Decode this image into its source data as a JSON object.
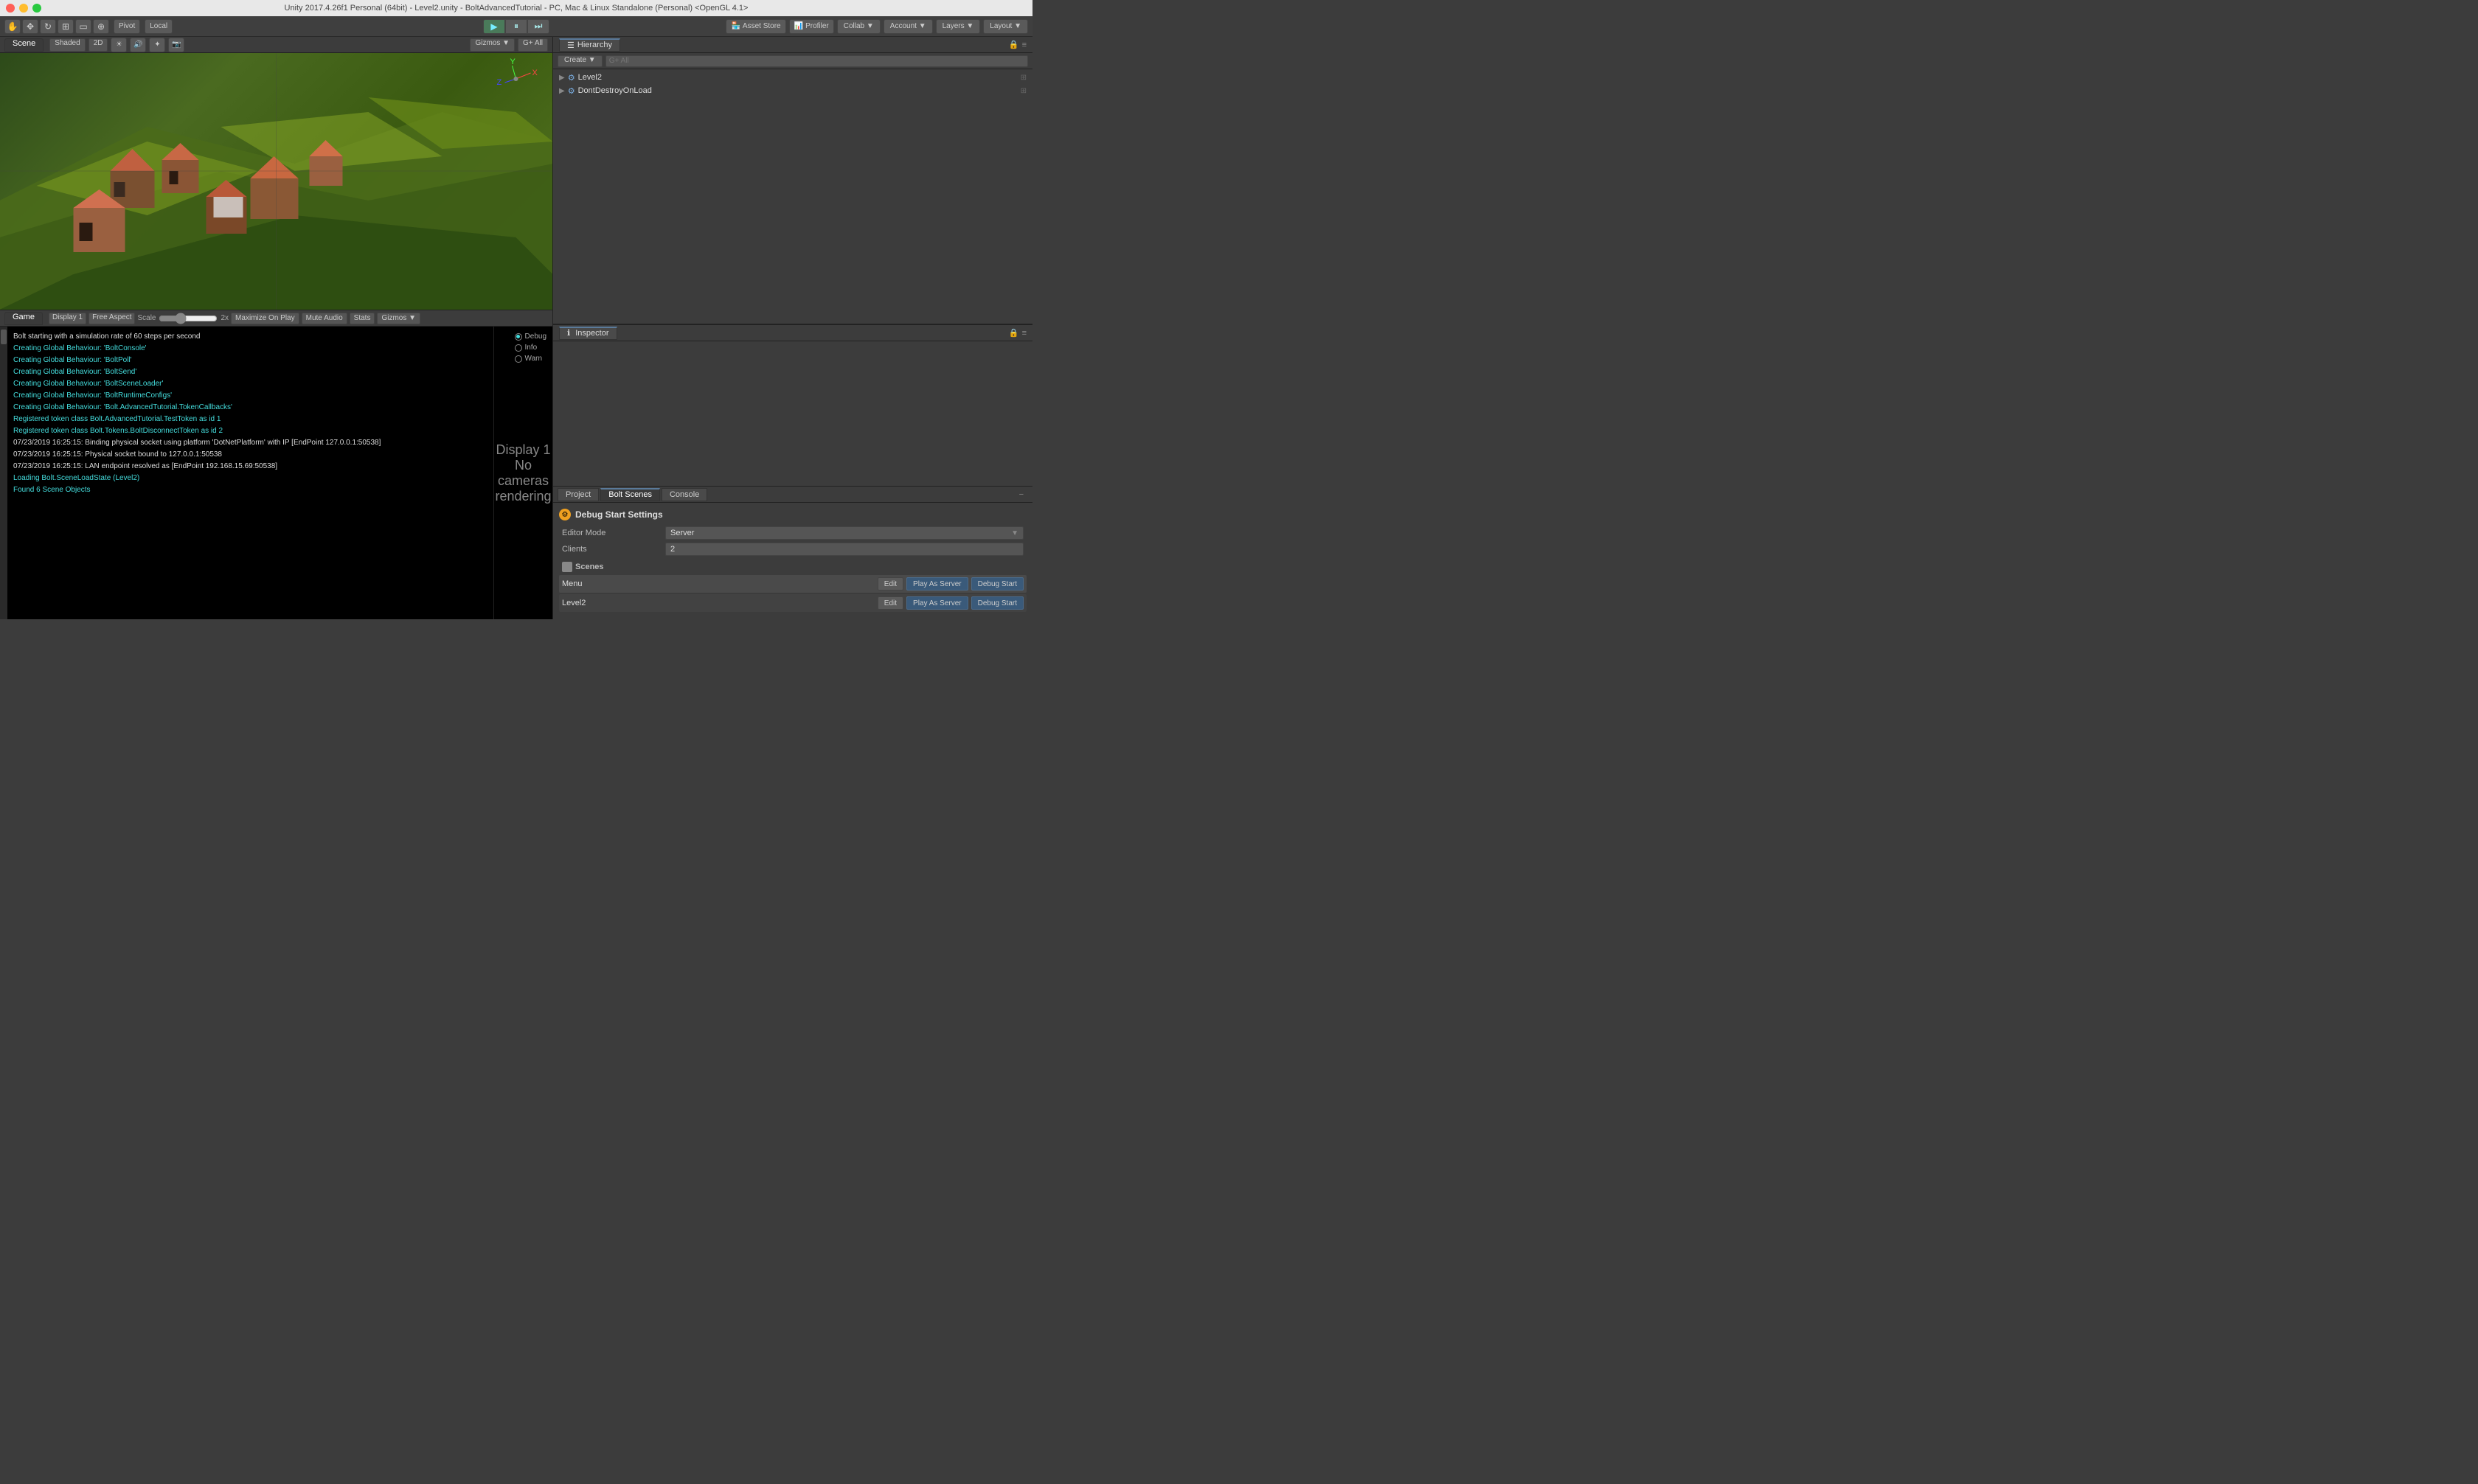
{
  "titlebar": {
    "text": "Unity 2017.4.26f1 Personal (64bit) - Level2.unity - BoltAdvancedTutorial - PC, Mac & Linux Standalone (Personal) <OpenGL 4.1>"
  },
  "toolbar": {
    "pivot_label": "Pivot",
    "local_label": "Local",
    "asset_store_label": "Asset Store",
    "profiler_label": "Profiler",
    "collab_label": "Collab ▼",
    "account_label": "Account ▼",
    "layers_label": "Layers ▼",
    "layout_label": "Layout ▼"
  },
  "scene_view": {
    "tab_label": "Scene",
    "shading_label": "Shaded",
    "mode_2d": "2D",
    "gizmos_label": "Gizmos ▼",
    "all_label": "G+ All"
  },
  "game_view": {
    "tab_label": "Game",
    "display_label": "Display 1",
    "aspect_label": "Free Aspect",
    "scale_label": "Scale",
    "scale_value": "2x",
    "maximize_label": "Maximize On Play",
    "mute_label": "Mute Audio",
    "stats_label": "Stats",
    "gizmos_label": "Gizmos ▼",
    "display_title": "Display 1",
    "no_cameras": "No cameras rendering"
  },
  "game_log": {
    "lines": [
      {
        "text": "Bolt starting with a simulation rate of 60 steps per second",
        "color": "white"
      },
      {
        "text": "Creating Global Behaviour: 'BoltConsole'",
        "color": "cyan"
      },
      {
        "text": "Creating Global Behaviour: 'BoltPoll'",
        "color": "cyan"
      },
      {
        "text": "Creating Global Behaviour: 'BoltSend'",
        "color": "cyan"
      },
      {
        "text": "Creating Global Behaviour: 'BoltSceneLoader'",
        "color": "cyan"
      },
      {
        "text": "Creating Global Behaviour: 'BoltRuntimeConfigs'",
        "color": "cyan"
      },
      {
        "text": "Creating Global Behaviour: 'Bolt.AdvancedTutorial.TokenCallbacks'",
        "color": "cyan"
      },
      {
        "text": "Registered token class Bolt.AdvancedTutorial.TestToken as id 1",
        "color": "cyan"
      },
      {
        "text": "Registered token class Bolt.Tokens.BoltDisconnectToken as id 2",
        "color": "cyan"
      },
      {
        "text": "07/23/2019 16:25:15: Binding physical socket using platform 'DotNetPlatform' with IP [EndPoint 127.0.0.1:50538]",
        "color": "white"
      },
      {
        "text": "07/23/2019 16:25:15: Physical socket bound to 127.0.0.1:50538",
        "color": "white"
      },
      {
        "text": "07/23/2019 16:25:15: LAN endpoint resolved as [EndPoint 192.168.15.69:50538]",
        "color": "white"
      },
      {
        "text": "Loading Bolt.SceneLoadState (Level2)",
        "color": "cyan"
      },
      {
        "text": "Found 6 Scene Objects",
        "color": "cyan"
      }
    ],
    "radio_options": [
      {
        "label": "Debug",
        "checked": true
      },
      {
        "label": "Info",
        "checked": false
      },
      {
        "label": "Warn",
        "checked": false
      }
    ]
  },
  "hierarchy": {
    "tab_label": "Hierarchy",
    "create_label": "Create ▼",
    "search_placeholder": "G+ All",
    "items": [
      {
        "name": "Level2",
        "icon": "▶",
        "indent": 0
      },
      {
        "name": "DontDestroyOnLoad",
        "icon": "▶",
        "indent": 0
      }
    ]
  },
  "inspector": {
    "tab_label": "Inspector"
  },
  "bottom_panel": {
    "tabs": [
      {
        "label": "Project",
        "active": false
      },
      {
        "label": "Bolt Scenes",
        "active": true
      },
      {
        "label": "Console",
        "active": false
      }
    ],
    "debug_title": "Debug Start Settings",
    "editor_mode_label": "Editor Mode",
    "editor_mode_value": "Server",
    "clients_label": "Clients",
    "clients_value": "2",
    "scenes_label": "Scenes",
    "scenes": [
      {
        "name": "Menu",
        "edit_label": "Edit",
        "play_as_server_label": "Play As Server",
        "debug_start_label": "Debug Start"
      },
      {
        "name": "Level2",
        "edit_label": "Edit",
        "play_as_server_label": "Play As Server",
        "debug_start_label": "Debug Start"
      }
    ]
  }
}
